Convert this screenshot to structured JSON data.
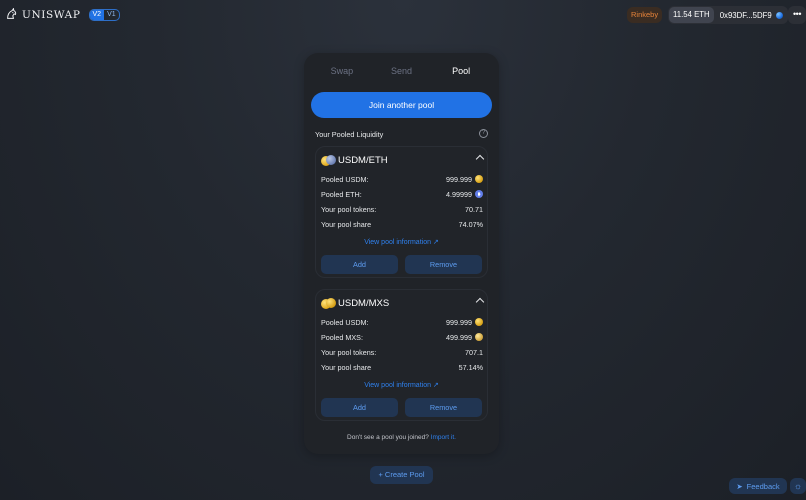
{
  "header": {
    "brand": "UNISWAP",
    "versions": [
      "V2",
      "V1"
    ],
    "active_version": "V2",
    "network": "Rinkeby",
    "eth_balance": "11.54 ETH",
    "address": "0x93DF...5DF9",
    "more_label": "•••"
  },
  "tabs": [
    {
      "label": "Swap",
      "active": false
    },
    {
      "label": "Send",
      "active": false
    },
    {
      "label": "Pool",
      "active": true
    }
  ],
  "join_button": "Join another pool",
  "pooled_title": "Your Pooled Liquidity",
  "help_glyph": "?",
  "pools": [
    {
      "pair": "USDM/ETH",
      "rows": [
        {
          "label": "Pooled USDM:",
          "value": "999.999",
          "icon": "usdm-icon"
        },
        {
          "label": "Pooled ETH:",
          "value": "4.99999",
          "icon": "eth-icon"
        },
        {
          "label": "Your pool tokens:",
          "value": "70.71"
        },
        {
          "label": "Your pool share",
          "value": "74.07%"
        }
      ],
      "view_link": "View pool information ↗",
      "add_label": "Add",
      "remove_label": "Remove"
    },
    {
      "pair": "USDM/MXS",
      "rows": [
        {
          "label": "Pooled USDM:",
          "value": "999.999",
          "icon": "usdm-icon"
        },
        {
          "label": "Pooled MXS:",
          "value": "499.999",
          "icon": "mxs-icon"
        },
        {
          "label": "Your pool tokens:",
          "value": "707.1"
        },
        {
          "label": "Your pool share",
          "value": "57.14%"
        }
      ],
      "view_link": "View pool information ↗",
      "add_label": "Add",
      "remove_label": "Remove"
    }
  ],
  "footnote": {
    "text": "Don't see a pool you joined?",
    "link": "Import it."
  },
  "create_pool": "+ Create Pool",
  "feedback": "Feedback",
  "feedback_glyph": "➤",
  "theme_glyph": "☼",
  "colors": {
    "accent": "#2172e5",
    "network": "#e6833a",
    "card": "#202328",
    "background": "#232830"
  }
}
